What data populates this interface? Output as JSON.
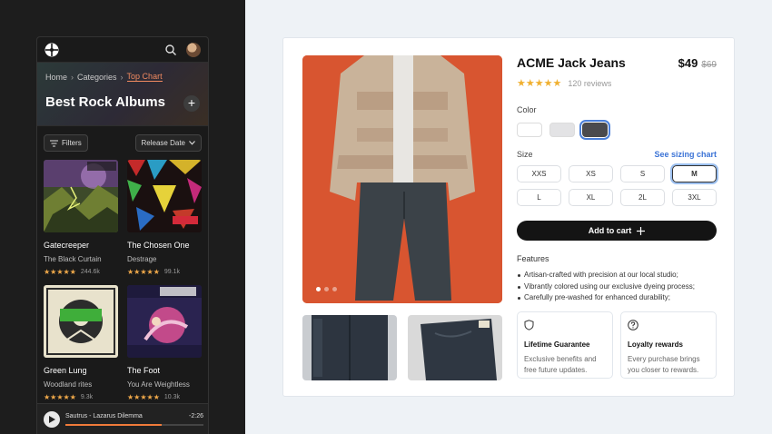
{
  "app": {
    "breadcrumbs": [
      "Home",
      "Categories",
      "Top Chart"
    ],
    "page_title": "Best Rock Albums",
    "filters_label": "Filters",
    "sort_label": "Release Date",
    "albums": [
      {
        "title": "Gatecreeper",
        "artist": "The Black Curtain",
        "count": "244.6k"
      },
      {
        "title": "The Chosen One",
        "artist": "Destrage",
        "count": "99.1k"
      },
      {
        "title": "Green Lung",
        "artist": "Woodland rites",
        "count": "9.3k"
      },
      {
        "title": "The Foot",
        "artist": "You Are Weightless",
        "count": "10.3k"
      }
    ],
    "player": {
      "track": "Sautrus - Lazarus Dilemma",
      "time": "-2:26",
      "progress_percent": 70
    }
  },
  "product": {
    "title": "ACME Jack Jeans",
    "price": "$49",
    "old_price": "$69",
    "reviews": "120 reviews",
    "rating": 5,
    "color_label": "Color",
    "colors": [
      "#ffffff",
      "#e3e3e5",
      "#4a4a4e"
    ],
    "size_label": "Size",
    "sizing_link": "See sizing chart",
    "sizes": [
      "XXS",
      "XS",
      "S",
      "M",
      "L",
      "XL",
      "2L",
      "3XL"
    ],
    "selected_size": "M",
    "add_to_cart": "Add to cart",
    "features_title": "Features",
    "features": [
      "Artisan-crafted with precision at our local studio;",
      "Vibrantly colored using our exclusive dyeing process;",
      "Carefully pre-washed for enhanced durability;"
    ],
    "perks": [
      {
        "title": "Lifetime Guarantee",
        "text": "Exclusive benefits and free future updates.",
        "icon": "shield-icon"
      },
      {
        "title": "Loyalty rewards",
        "text": "Every purchase brings you closer to rewards.",
        "icon": "help-circle-icon"
      }
    ],
    "carousel_dots": 3,
    "accent": "#3b73d6"
  }
}
